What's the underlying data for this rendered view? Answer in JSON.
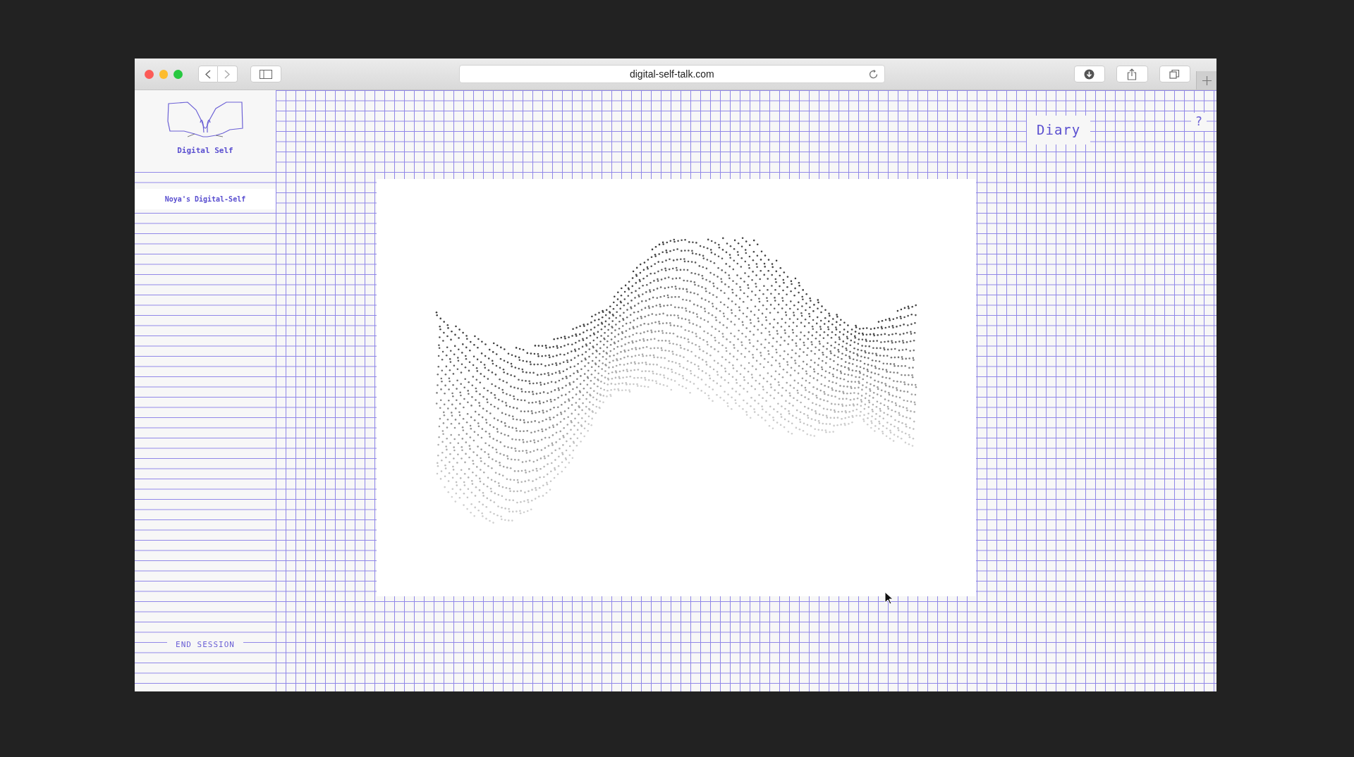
{
  "browser": {
    "url": "digital-self-talk.com"
  },
  "logo": {
    "label": "Digital Self"
  },
  "sidebar": {
    "items": [
      {
        "label": "Noya's Digital-Self",
        "selected": true
      }
    ],
    "end_session": "END SESSION"
  },
  "header": {
    "nav": "Diary",
    "help": "?"
  }
}
